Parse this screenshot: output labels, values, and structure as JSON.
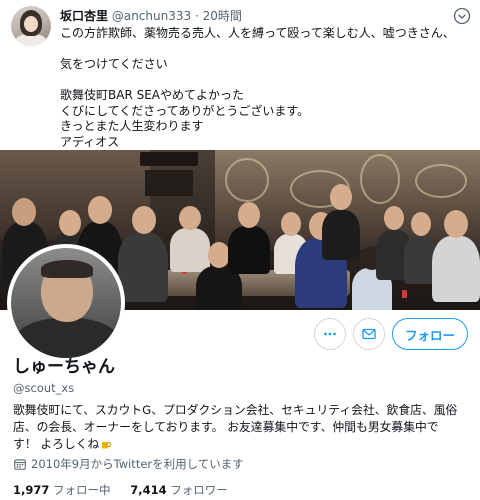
{
  "tweet": {
    "author_name": "坂口杏里",
    "author_handle": "@anchun333",
    "separator": "·",
    "time": "20時間",
    "lines": [
      "この方詐欺師、薬物売る売人、人を縛って殴って楽しむ人、嘘つきさん、",
      "",
      "気をつけてください",
      "",
      "歌舞伎町BAR SEAやめてよかった",
      "くびにしてくださってありがとうございます。",
      "きっとまた人生変わります",
      "アディオス"
    ],
    "menu_icon": "more-options-icon"
  },
  "profile": {
    "display_name": "しゅーちゃん",
    "username": "@scout_xs",
    "bio_lines": [
      "歌舞伎町にて、スカウトG、プロダクション会社、セキュリティ会社、飲食店、風俗",
      "店、の会長、オーナーをしております。 お友達募集中です、仲間も男女募集中で",
      "す！ よろしくね"
    ],
    "bio_emoji": "beer-mug-icon",
    "joined": "2010年9月からTwitterを利用しています",
    "following_count": "1,977",
    "following_label": "フォロー中",
    "followers_count": "7,414",
    "followers_label": "フォロワー"
  },
  "actions": {
    "more_icon": "more-icon",
    "message_icon": "envelope-icon",
    "follow_label": "フォロー"
  },
  "colors": {
    "accent": "#1d9bf0",
    "secondary_text": "#536471",
    "primary_text": "#0f1419"
  }
}
